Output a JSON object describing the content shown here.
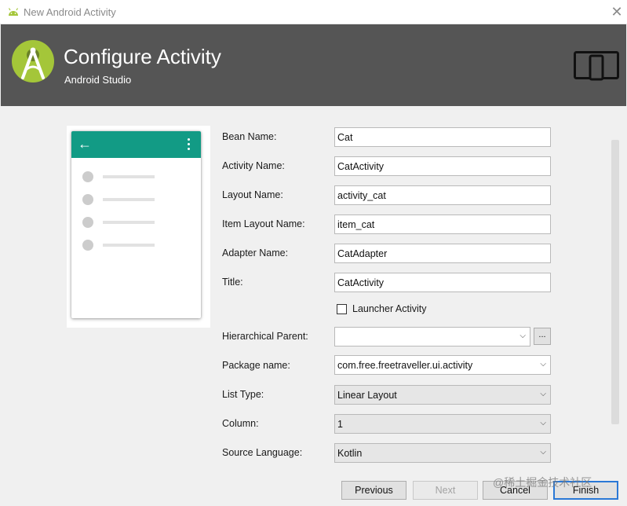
{
  "window": {
    "title": "New Android Activity",
    "close_glyph": "✕"
  },
  "header": {
    "title": "Configure Activity",
    "subtitle": "Android Studio"
  },
  "preview": {
    "back_glyph": "←"
  },
  "form": {
    "bean_name": {
      "label": "Bean Name:",
      "value": "Cat"
    },
    "activity_name": {
      "label": "Activity Name:",
      "value": "CatActivity"
    },
    "layout_name": {
      "label": "Layout Name:",
      "value": "activity_cat"
    },
    "item_layout_name": {
      "label": "Item Layout Name:",
      "value": "item_cat"
    },
    "adapter_name": {
      "label": "Adapter Name:",
      "value": "CatAdapter"
    },
    "title": {
      "label": "Title:",
      "value": "CatActivity"
    },
    "launcher_activity": {
      "label": "Launcher Activity",
      "checked": false
    },
    "hierarchical_parent": {
      "label": "Hierarchical Parent:",
      "value": "",
      "browse_label": "..."
    },
    "package_name": {
      "label": "Package name:",
      "value": "com.free.freetraveller.ui.activity"
    },
    "list_type": {
      "label": "List Type:",
      "value": "Linear Layout"
    },
    "column": {
      "label": "Column:",
      "value": "1"
    },
    "source_language": {
      "label": "Source Language:",
      "value": "Kotlin"
    }
  },
  "buttons": {
    "previous": "Previous",
    "next": "Next",
    "cancel": "Cancel",
    "finish": "Finish"
  },
  "watermark": "@稀土掘金技术社区",
  "colors": {
    "header_bg": "#555555",
    "appbar": "#129b85",
    "android_green": "#a4c639",
    "focus_border": "#2a78d6"
  },
  "icons": {
    "window": "android-icon",
    "logo": "android-studio-logo",
    "device": "device-layout-icon",
    "dropdown": "chevron-down-icon"
  }
}
